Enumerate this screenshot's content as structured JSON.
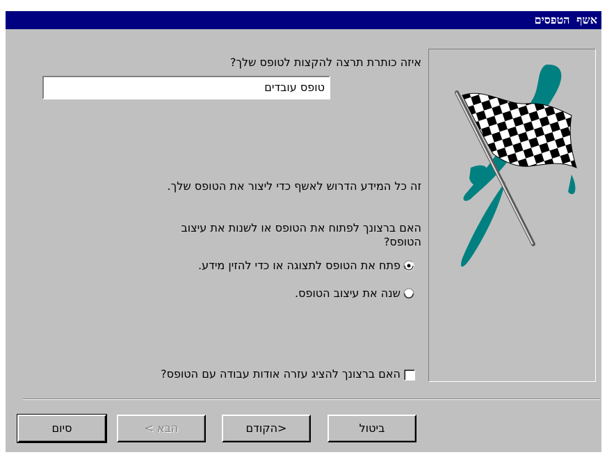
{
  "window": {
    "title": "אשף הטפסים"
  },
  "prompt": {
    "title_question": "איזה כותרת תרצה להקצות לטופס שלך?"
  },
  "title_input": {
    "value": "טופס עובדים"
  },
  "info": {
    "all_info_text": "זה כל המידע הדרוש לאשף כדי ליצור את הטופס שלך."
  },
  "open_question": {
    "line1": "האם ברצונך לפתוח את הטופס או לשנות את עיצוב",
    "line2": "הטופס?"
  },
  "options": [
    {
      "label": "פתח את הטופס לתצוגה או כדי להזין מידע.",
      "selected": true
    },
    {
      "label": "שנה את עיצוב הטופס.",
      "selected": false
    }
  ],
  "help_checkbox": {
    "label": "האם ברצונך להציג עזרה אודות עבודה עם הטופס?",
    "checked": false
  },
  "buttons": {
    "cancel": "ביטול",
    "back": "<הקודם",
    "next": "הבא >",
    "finish": "סיום"
  },
  "colors": {
    "titlebar": "#000080",
    "dialog": "#c0c0c0",
    "flag_swoosh": "#008080"
  }
}
